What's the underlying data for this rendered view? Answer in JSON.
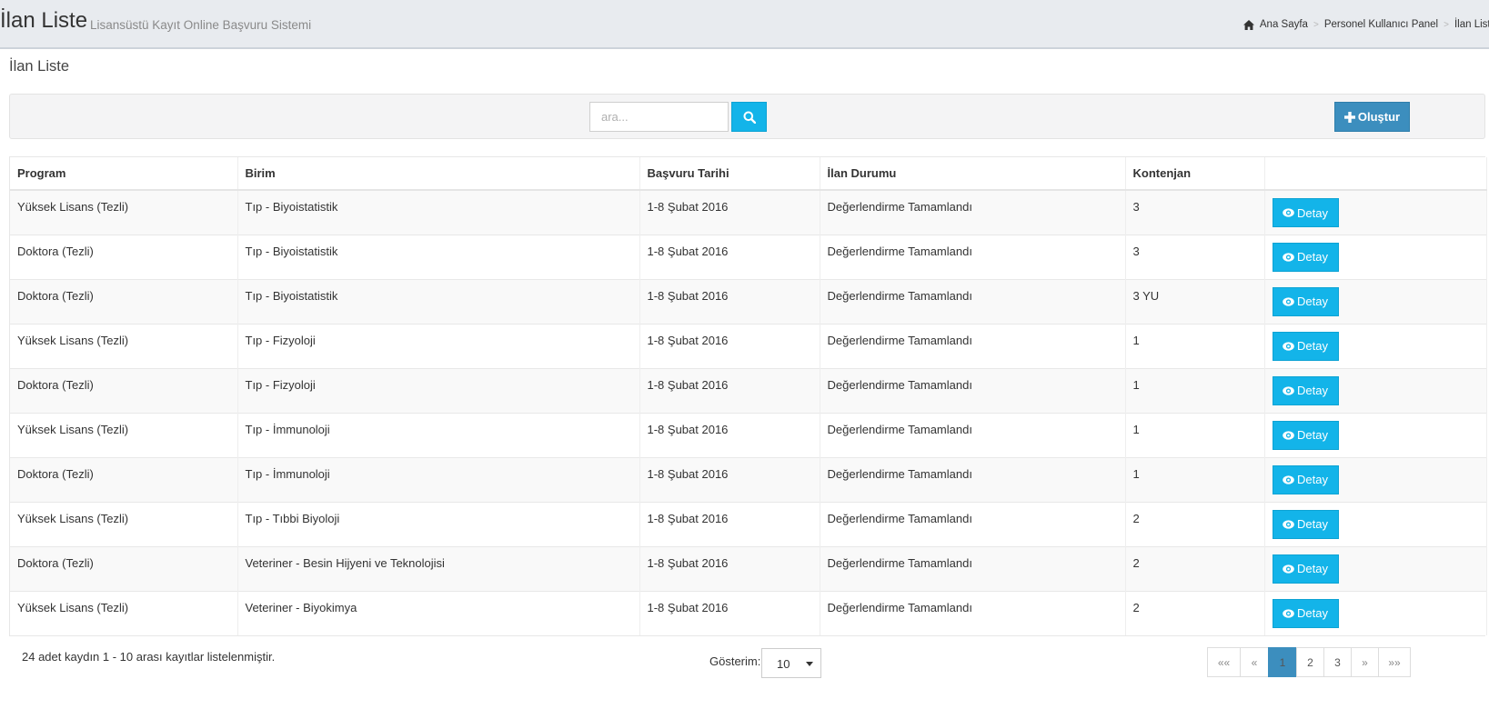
{
  "header": {
    "title": "İlan Liste",
    "subtitle": "Lisansüstü Kayıt Online Başvuru Sistemi",
    "breadcrumb": [
      "Ana Sayfa",
      "Personel Kullanıcı Panel",
      "İlan Liste"
    ],
    "breadcrumb_separator": ">",
    "home_icon": "home-icon"
  },
  "section": {
    "title": "İlan Liste"
  },
  "toolbar": {
    "search_placeholder": "ara...",
    "search_value": "",
    "search_icon": "search-icon",
    "create_label": "Oluştur",
    "create_icon": "plus-icon"
  },
  "table": {
    "columns": [
      "Program",
      "Birim",
      "Başvuru Tarihi",
      "İlan Durumu",
      "Kontenjan",
      ""
    ],
    "action_label": "Detay",
    "action_icon": "eye-icon",
    "rows": [
      {
        "program": "Yüksek Lisans (Tezli)",
        "birim": "Tıp - Biyoistatistik",
        "tarih": "1-8 Şubat 2016",
        "durum": "Değerlendirme Tamamlandı",
        "kontenjan": "3"
      },
      {
        "program": "Doktora (Tezli)",
        "birim": "Tıp - Biyoistatistik",
        "tarih": "1-8 Şubat 2016",
        "durum": "Değerlendirme Tamamlandı",
        "kontenjan": "3"
      },
      {
        "program": "Doktora (Tezli)",
        "birim": "Tıp - Biyoistatistik",
        "tarih": "1-8 Şubat 2016",
        "durum": "Değerlendirme Tamamlandı",
        "kontenjan": "3 YU"
      },
      {
        "program": "Yüksek Lisans (Tezli)",
        "birim": "Tıp - Fizyoloji",
        "tarih": "1-8 Şubat 2016",
        "durum": "Değerlendirme Tamamlandı",
        "kontenjan": "1"
      },
      {
        "program": "Doktora (Tezli)",
        "birim": "Tıp - Fizyoloji",
        "tarih": "1-8 Şubat 2016",
        "durum": "Değerlendirme Tamamlandı",
        "kontenjan": "1"
      },
      {
        "program": "Yüksek Lisans (Tezli)",
        "birim": "Tıp - İmmunoloji",
        "tarih": "1-8 Şubat 2016",
        "durum": "Değerlendirme Tamamlandı",
        "kontenjan": "1"
      },
      {
        "program": "Doktora (Tezli)",
        "birim": "Tıp - İmmunoloji",
        "tarih": "1-8 Şubat 2016",
        "durum": "Değerlendirme Tamamlandı",
        "kontenjan": "1"
      },
      {
        "program": "Yüksek Lisans (Tezli)",
        "birim": "Tıp - Tıbbi Biyoloji",
        "tarih": "1-8 Şubat 2016",
        "durum": "Değerlendirme Tamamlandı",
        "kontenjan": "2"
      },
      {
        "program": "Doktora (Tezli)",
        "birim": "Veteriner - Besin Hijyeni ve Teknolojisi",
        "tarih": "1-8 Şubat 2016",
        "durum": "Değerlendirme Tamamlandı",
        "kontenjan": "2"
      },
      {
        "program": "Yüksek Lisans (Tezli)",
        "birim": "Veteriner - Biyokimya",
        "tarih": "1-8 Şubat 2016",
        "durum": "Değerlendirme Tamamlandı",
        "kontenjan": "2"
      }
    ]
  },
  "footer": {
    "info": "24 adet kaydın 1 - 10 arası kayıtlar listelenmiştir.",
    "page_size_label": "Gösterim:",
    "page_size_value": "10",
    "pagination": {
      "first": "««",
      "prev": "«",
      "pages": [
        "1",
        "2",
        "3"
      ],
      "current": "1",
      "next": "»",
      "last": "»»"
    }
  },
  "colors": {
    "header_bg": "#e8ebef",
    "info_button": "#13b4e9",
    "primary_button": "#3c8ebe",
    "text": "#333333"
  }
}
